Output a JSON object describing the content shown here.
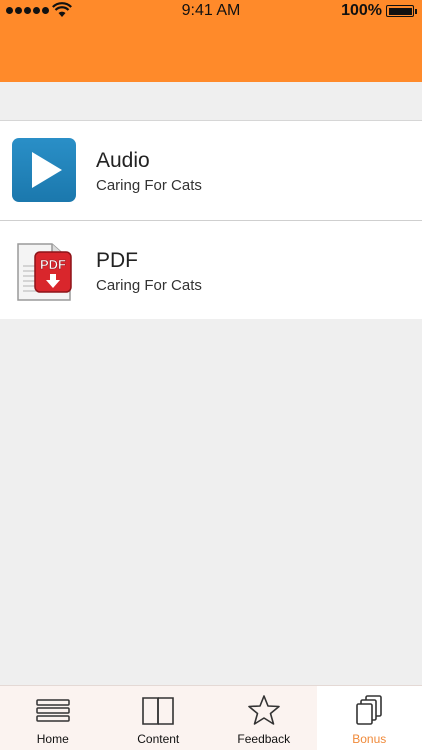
{
  "status_bar": {
    "time": "9:41 AM",
    "battery_percent": "100%"
  },
  "colors": {
    "accent": "#ff8a2a",
    "active_tab": "#f08a3a",
    "play_blue": "#2a8fc7",
    "pdf_red": "#d9262c"
  },
  "items": [
    {
      "title": "Audio",
      "subtitle": "Caring For Cats",
      "icon": "play-icon"
    },
    {
      "title": "PDF",
      "subtitle": "Caring For Cats",
      "icon": "pdf-icon",
      "badge_text": "PDF"
    }
  ],
  "tabs": [
    {
      "label": "Home",
      "icon": "menu-lines-icon",
      "active": false
    },
    {
      "label": "Content",
      "icon": "book-icon",
      "active": false
    },
    {
      "label": "Feedback",
      "icon": "star-icon",
      "active": false
    },
    {
      "label": "Bonus",
      "icon": "pages-icon",
      "active": true
    }
  ]
}
